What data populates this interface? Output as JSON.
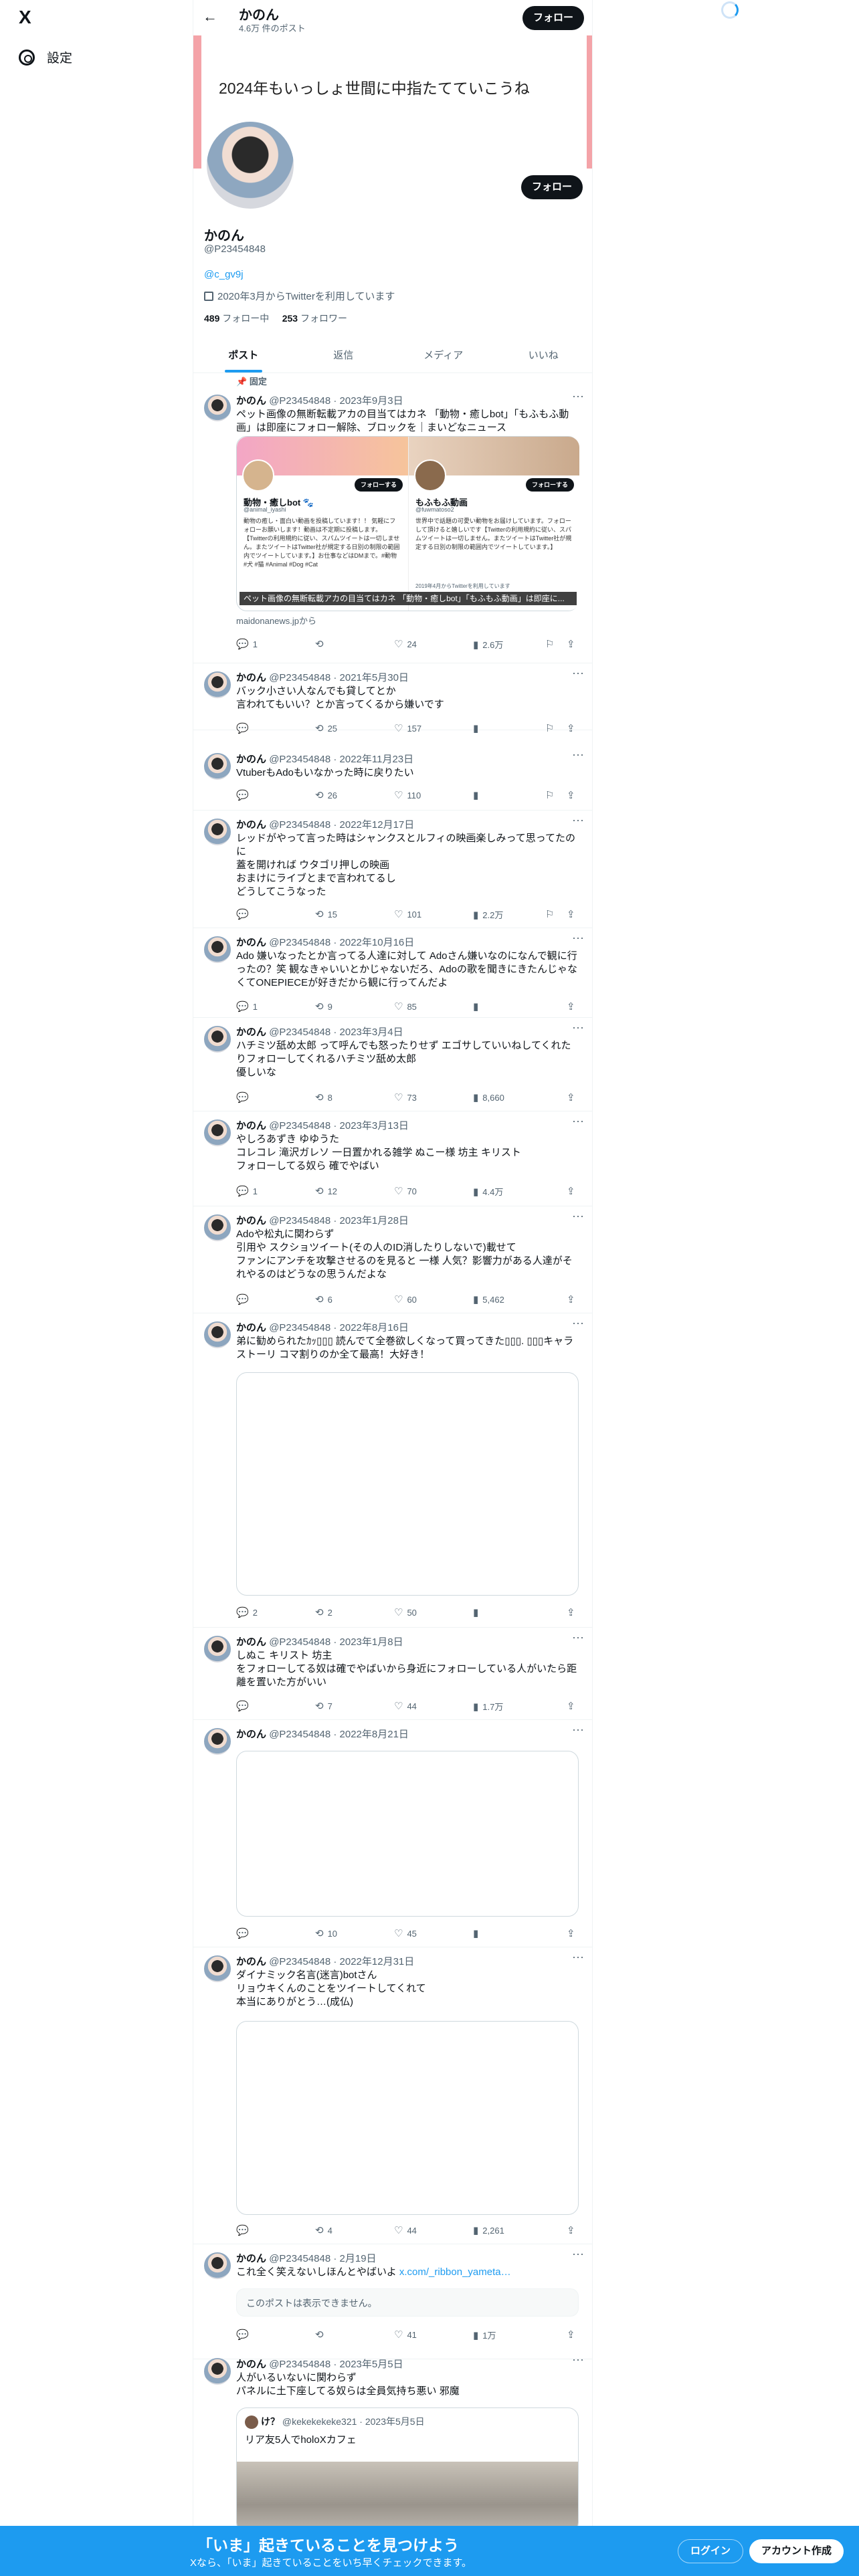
{
  "nav": {
    "logo": "X",
    "settings_label": "設定"
  },
  "header": {
    "name": "かのん",
    "post_count": "4.6万 件のポスト",
    "follow_label": "フォロー"
  },
  "banner": {
    "text": "2024年もいっしょ世間に中指たてていこうね　　＿！！"
  },
  "profile": {
    "name": "かのん",
    "handle": "@P23454848",
    "link": "@c_gv9j",
    "joined": "2020年3月からTwitterを利用しています",
    "following_count": "489",
    "following_label": " フォロー中",
    "followers_count": "253",
    "followers_label": " フォロワー",
    "follow_label": "フォロー"
  },
  "tabs": [
    "ポスト",
    "返信",
    "メディア",
    "いいね"
  ],
  "pinned_label": "固定",
  "author": {
    "name": "かのん",
    "handle": "@P23454848"
  },
  "tweets": [
    {
      "date": "2023年9月3日",
      "text": "ペット画像の無断転載アカの目当てはカネ 「動物・癒しbot」「もふもふ動画」は即座にフォロー解除、ブロックを｜まいどなニュース",
      "card": {
        "left_name": "動物・癒しbot 🐾",
        "left_handle": "@animal_iyashi",
        "left_body": "動物の癒し・面白い動画を投稿しています！！ 気軽にフォローお願いします！動画は不定期に投稿します。【Twitterの利用規約に従い、スパムツイートは一切しません。またツイートはTwitter社が規定する日別の制限の範囲内でツイートしています。】お仕事などはDMまで。#動物 #犬 #猫 #Animal #Dog #Cat",
        "right_name": "もふもふ動画",
        "right_handle": "@fuwmatoso2",
        "right_body": "世界中で話題の可愛い動物をお届けしています。フォローして頂けると嬉しいです【Twitterの利用規約に従い、スパムツイートは一切しません。またツイートはTwitter社が規定する日別の制限の範囲内でツイートしています。】",
        "follow_label": "フォローする",
        "caption": "ペット画像の無断転載アカの目当てはカネ 「動物・癒しbot」「もふもふ動画」は即座に...",
        "meta": "2019年4月からTwitterを利用しています",
        "domain": "maidonanews.jpから"
      },
      "reply": "1",
      "retweet": "",
      "like": "24",
      "views": "2.6万"
    },
    {
      "date": "2021年5月30日",
      "text": "バック小さい人なんでも貸してとか\n言われてもいい？とか言ってくるから嫌いです",
      "reply": "",
      "retweet": "25",
      "like": "157",
      "views": ""
    },
    {
      "date": "2022年11月23日",
      "text": "VtuberもAdoもいなかった時に戻りたい",
      "reply": "",
      "retweet": "26",
      "like": "110",
      "views": ""
    },
    {
      "date": "2022年12月17日",
      "text": "レッドがやって言った時はシャンクスとルフィの映画楽しみって思ってたのに\n蓋を開ければ ウタゴリ押しの映画\nおまけにライブとまで言われてるし\nどうしてこうなった",
      "reply": "",
      "retweet": "15",
      "like": "101",
      "views": "2.2万"
    },
    {
      "date": "2022年10月16日",
      "text": "Ado 嫌いなったとか言ってる人達に対して Adoさん嫌いなのになんで観に行ったの？笑 観なきゃいいとかじゃないだろ、Adoの歌を聞きにきたんじゃなくてONEPIECEが好きだから観に行ってんだよ",
      "reply": "1",
      "retweet": "9",
      "like": "85",
      "views": ""
    },
    {
      "date": "2023年3月4日",
      "text": "ハチミツ舐め太郎 って呼んでも怒ったりせず エゴサしていいねしてくれたりフォローしてくれるハチミツ舐め太郎\n優しいな",
      "reply": "",
      "retweet": "8",
      "like": "73",
      "views": "8,660"
    },
    {
      "date": "2023年3月13日",
      "text": "やしろあずき ゆゆうた\nコレコレ 滝沢ガレソ 一日置かれる雑学 ぬこー様 坊主 キリスト\nフォローしてる奴ら 確でやばい",
      "reply": "1",
      "retweet": "12",
      "like": "70",
      "views": "4.4万"
    },
    {
      "date": "2023年1月28日",
      "text": "Adoや松丸に関わらず\n引用や スクショツイート(その人のID消したりしないで)載せて\nファンにアンチを攻撃させるのを見ると 一様 人気？影響力がある人達がそれやるのはどうなの思うんだよな",
      "reply": "",
      "retweet": "6",
      "like": "60",
      "views": "5,462"
    },
    {
      "date": "2022年8月16日",
      "text": "弟に勧められたｶｯ▯▯▯ 読んでて全巻欲しくなって買ってきた▯▯▯. ▯▯▯キャラ ストーリ コマ割りのか全て最高！大好き！",
      "reply": "2",
      "retweet": "2",
      "like": "50",
      "views": ""
    },
    {
      "date": "2023年1月8日",
      "text": "しぬこ キリスト 坊主\nをフォローしてる奴は確でやばいから身近にフォローしている人がいたら距離を置いた方がいい",
      "reply": "",
      "retweet": "7",
      "like": "44",
      "views": "1.7万"
    },
    {
      "date": "2022年8月21日",
      "text": "",
      "reply": "",
      "retweet": "10",
      "like": "45",
      "views": ""
    },
    {
      "date": "2022年12月31日",
      "text": "ダイナミック名言(迷言)botさん\nリョウキくんのことをツイートしてくれて\n本当にありがとう…(成仏)",
      "reply": "",
      "retweet": "4",
      "like": "44",
      "views": "2,261"
    },
    {
      "date": "2月19日",
      "text": "これ全く笑えないしほんとやばいよ ",
      "link": "x.com/_ribbon_yameta…",
      "quote_unavailable": "このポストは表示できません。",
      "reply": "",
      "retweet": "",
      "like": "41",
      "views": "1万"
    },
    {
      "date": "2023年5月5日",
      "text": "人がいるいないに関わらず\nパネルに土下座してる奴らは全員気持ち悪い 邪魔",
      "quote": {
        "name": "け？",
        "handle": "@kekekekeke321",
        "date": "2023年5月5日",
        "text": "リア友5人でholoXカフェ"
      }
    }
  ],
  "bottom": {
    "title": "「いま」起きていることを見つけよう",
    "subtitle": "Xなら、「いま」起きていることをいち早くチェックできます。",
    "login_label": "ログイン",
    "signup_label": "アカウント作成"
  }
}
